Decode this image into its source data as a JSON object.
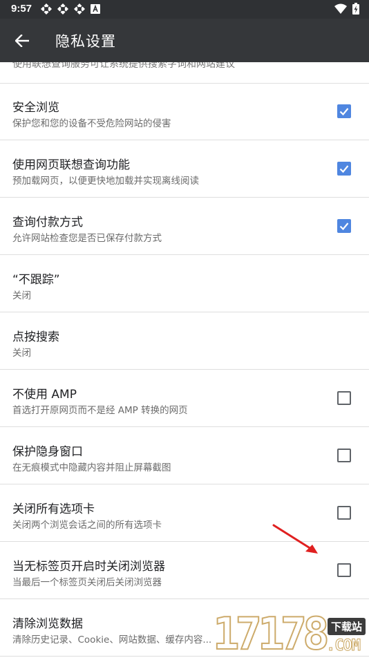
{
  "status_bar": {
    "time": "9:57",
    "left_icons": [
      "app-notification-icon",
      "app-notification-icon",
      "app-notification-icon",
      "a-letter-icon"
    ],
    "right_icons": [
      "wifi-icon",
      "battery-charging-icon"
    ]
  },
  "app_bar": {
    "title": "隐私设置",
    "back_icon": "arrow-back-icon"
  },
  "partial_row": {
    "text": "使用联想查询服务可让系统提供搜索字词和网站建议"
  },
  "rows": [
    {
      "title": "安全浏览",
      "subtitle": "保护您和您的设备不受危险网站的侵害",
      "checkbox": "checked"
    },
    {
      "title": "使用网页联想查询功能",
      "subtitle": "预加载网页，以便更快地加载并实现离线阅读",
      "checkbox": "checked"
    },
    {
      "title": "查询付款方式",
      "subtitle": "允许网站检查您是否已保存付款方式",
      "checkbox": "checked"
    },
    {
      "title": "“不跟踪”",
      "subtitle": "关闭",
      "checkbox": "none"
    },
    {
      "title": "点按搜索",
      "subtitle": "关闭",
      "checkbox": "none"
    },
    {
      "title": "不使用 AMP",
      "subtitle": "首选打开原网页而不是经 AMP 转换的网页",
      "checkbox": "unchecked"
    },
    {
      "title": "保护隐身窗口",
      "subtitle": "在无痕模式中隐藏内容并阻止屏幕截图",
      "checkbox": "unchecked"
    },
    {
      "title": "关闭所有选项卡",
      "subtitle": "关闭两个浏览会话之间的所有选项卡",
      "checkbox": "unchecked"
    },
    {
      "title": "当无标签页开启时关闭浏览器",
      "subtitle": "当最后一个标签页关闭后关闭浏览器",
      "checkbox": "unchecked"
    },
    {
      "title": "清除浏览数据",
      "subtitle": "清除历史记录、Cookie、网站数据、缓存内容...",
      "checkbox": "none"
    }
  ],
  "colors": {
    "status_bar": "#2f3134",
    "app_bar": "#35373a",
    "checkbox_checked": "#4f86e0",
    "annotation_arrow": "#e02020",
    "divider": "#dedede"
  },
  "watermark": {
    "number": "17178",
    "site": "下载站",
    "domain": ".COM"
  }
}
